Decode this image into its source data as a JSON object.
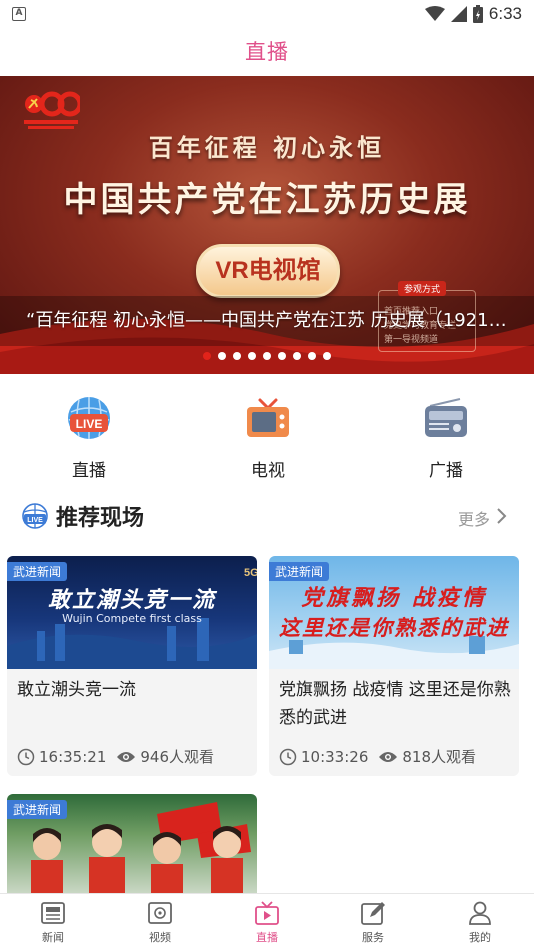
{
  "status_bar": {
    "time": "6:33",
    "left_icon_letter": "A"
  },
  "header": {
    "title": "直播"
  },
  "banner": {
    "title_line1": "百年征程 初心永恒",
    "title_line2": "中国共产党在江苏历史展",
    "vr_label": "VR电视馆",
    "caption": "“百年征程 初心永恒——中国共产党在江苏 历史展（1921…",
    "visit_tag": "参观方式",
    "visit_lines": [
      "首页推荐入口",
      "党史学习教育专栏",
      "第一导视频道"
    ],
    "dot_count": 9,
    "active_dot": 0
  },
  "categories": [
    {
      "label": "直播",
      "icon": "live-icon"
    },
    {
      "label": "电视",
      "icon": "tv-icon"
    },
    {
      "label": "广播",
      "icon": "radio-icon"
    }
  ],
  "section": {
    "title": "推荐现场",
    "more": "更多"
  },
  "cards": [
    {
      "tag": "武进新闻",
      "thumb_text": "敢立潮头竞一流",
      "thumb_sub": "Wujin Compete first class",
      "title": "敢立潮头竞一流",
      "time": "16:35:21",
      "views": "946人观看"
    },
    {
      "tag": "武进新闻",
      "thumb_text": "党旗飘扬 战疫情",
      "thumb_sub": "这里还是你熟悉的武进",
      "title": "党旗飘扬 战疫情 这里还是你熟悉的武进",
      "time": "10:33:26",
      "views": "818人观看"
    },
    {
      "tag": "武进新闻"
    }
  ],
  "bottom_nav": [
    {
      "label": "新闻",
      "icon": "news-icon",
      "active": false
    },
    {
      "label": "视频",
      "icon": "video-icon",
      "active": false
    },
    {
      "label": "直播",
      "icon": "live-tv-icon",
      "active": true
    },
    {
      "label": "服务",
      "icon": "service-icon",
      "active": false
    },
    {
      "label": "我的",
      "icon": "profile-icon",
      "active": false
    }
  ],
  "colors": {
    "accent": "#e0508a",
    "banner_red": "#8a2c1e",
    "tag_blue": "#3d7bd6",
    "active_dot": "#e2231a"
  }
}
